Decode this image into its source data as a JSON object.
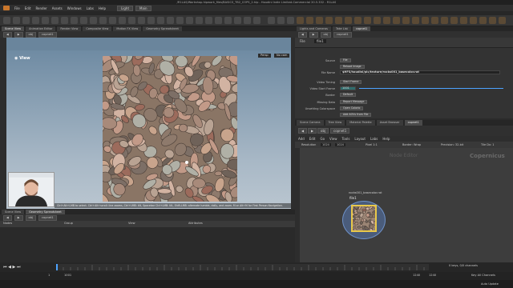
{
  "window": {
    "title": "/R1LAS/Workshop.hipwork_files/BASICS_TB2_COPS_2.hip - Houdini Indie Limited-Commercial 20.5.332 - R1LAS"
  },
  "menubar": {
    "items": [
      "File",
      "Edit",
      "Render",
      "Assets",
      "Windows",
      "Labs",
      "Help"
    ],
    "desktop_left": "Light",
    "desktop_right": "Main"
  },
  "left_tabs": [
    "Scene View",
    "Animation Editor",
    "Render View",
    "Composite View",
    "Motion FX View",
    "Geometry Spreadsheet"
  ],
  "left_nav": {
    "context": "obj",
    "node": "copnet1"
  },
  "viewport": {
    "title": "View",
    "persp_label": "Persp",
    "nocam_label": "No cam",
    "hint": "Ctrl+Alt+LMB to select. Ctrl+Alt+scroll: line zooms, Ctrl+LMB: tilt, Spacebar Ctrl+LMB: tilt, Shift-LMB: alternate tumble, dolly, and zoom. M or Alt+M for First Person Navigation."
  },
  "lower_left_tabs": [
    "Scene View",
    "Geometry Spreadsheet"
  ],
  "net_nav": {
    "context": "obj",
    "node": "copnet1"
  },
  "net_header": {
    "nodes": "Nodes",
    "group": "Group",
    "view": "View",
    "attribute": "Attributes"
  },
  "playbar": {
    "frame_start": "1",
    "frame_end": "1001",
    "current": "1001",
    "range_end": "1240",
    "range_end2": "1240"
  },
  "statusbar": {
    "keys": "0 keys, 0/0 channels",
    "key_all": "Key All Channels",
    "auto_update": "Auto Update"
  },
  "right_tabs": [
    "Lights and Cameras",
    "Take List",
    "copnet1"
  ],
  "right_nav": {
    "context": "obj",
    "node": "copnet1"
  },
  "params": {
    "node_type": "File",
    "node_name": "file1",
    "rows": [
      {
        "label": "Source",
        "value": "File"
      },
      {
        "label": "",
        "value": "Reload Image"
      },
      {
        "label": "File Name",
        "value": "$HFS/houdini/pic/texture/rocks001_basecolor.rat"
      },
      {
        "label": "Video Timing",
        "value": "Start Frame"
      },
      {
        "label": "Video Start Frame",
        "value": "1001"
      },
      {
        "label": "Border",
        "value": "Default"
      },
      {
        "label": "Missing Data",
        "value": "Report Message"
      },
      {
        "label": "Unsetting Colorspace",
        "value": "Open Colorio"
      },
      {
        "label": "",
        "value": "Add AOVs from File"
      }
    ]
  },
  "lower_right_tabs": [
    "Scene Camera",
    "Tree View",
    "Material Palette",
    "Asset Browser",
    "copnet1"
  ],
  "cop_menu": [
    "Add",
    "Edit",
    "Go",
    "View",
    "Tools",
    "Layout",
    "Labs",
    "Help"
  ],
  "cop_nav": {
    "context": "obj",
    "node": "copnet1"
  },
  "cop_info": {
    "resolution_label": "Resolution",
    "res_x": "1024",
    "res_y": "1024",
    "pixel": "Pixel 1:1",
    "border": "Border: Wrap",
    "precision": "Precision: 32-bit",
    "tile": "Tile Dx: 1"
  },
  "network": {
    "watermark_left": "Node Editor",
    "watermark_right": "Copernicus",
    "node_name": "rocks001_basecolor.rat",
    "node_label": "file1"
  },
  "colors": {
    "accent": "#e8c84a",
    "network_bg": "#3d3d3d",
    "viewport_top": "#6f8ba3"
  }
}
